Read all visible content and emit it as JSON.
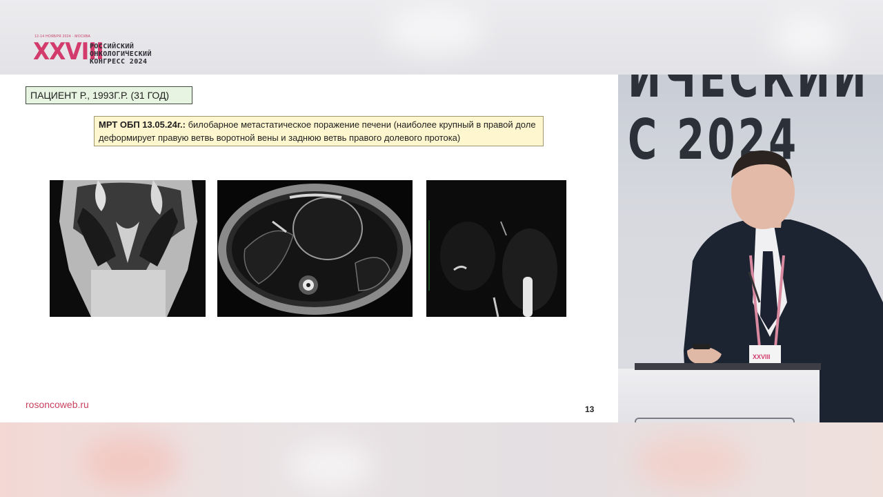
{
  "logo": {
    "dates": "12-14 НОЯБРЯ 2024 · МОСКВА",
    "numeral": "XXVIII",
    "line1": "РОССИЙСКИЙ",
    "line2": "ОНКОЛОГИЧЕСКИЙ",
    "line3": "КОНГРЕСС 2024"
  },
  "slide": {
    "patient_label": "ПАЦИЕНТ Р., 1993Г.Р. (31 ГОД)",
    "mrt_title": "МРТ ОБП 13.05.24г.:",
    "mrt_text": " билобарное метастатическое поражение печени (наиболее крупный в правой доле деформирует правую ветвь воротной вены и заднюю ветвь правого долевого протока)",
    "site_url": "rosoncoweb.ru",
    "page_number": "13"
  },
  "camera": {
    "backdrop_line1": "ИЧЕСКИЙ",
    "backdrop_line2": "С 2024",
    "badge_text": "XXVIII"
  },
  "colors": {
    "brand_pink": "#d23b6b",
    "patient_box_bg": "#e6f4e1",
    "mrt_box_bg": "#fdf6cf",
    "url_color": "#c9425e"
  }
}
